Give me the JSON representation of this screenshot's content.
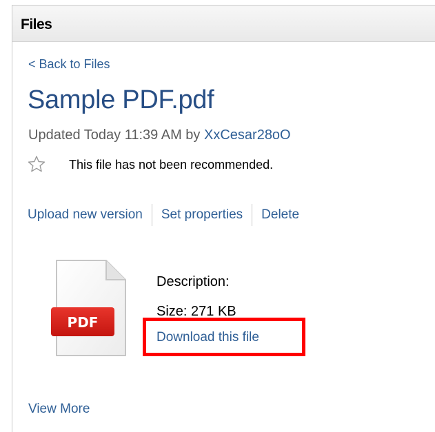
{
  "panel": {
    "title": "Files"
  },
  "nav": {
    "back_label": "< Back to Files"
  },
  "file": {
    "name": "Sample PDF.pdf",
    "updated_prefix": "Updated Today 11:39 AM by ",
    "updated_by": "XxCesar28oO",
    "recommend_text": "This file has not been recommended.",
    "icon_label": "PDF",
    "description_label": "Description:",
    "size_label": "Size: 271 KB",
    "download_label": "Download this file"
  },
  "actions": [
    {
      "label": "Upload new version"
    },
    {
      "label": "Set properties"
    },
    {
      "label": "Delete"
    }
  ],
  "footer": {
    "view_more_label": "View More"
  },
  "colors": {
    "link": "#2f5f96",
    "title": "#274e85",
    "pdf_badge": "#d9221b",
    "highlight": "#ff0000"
  }
}
